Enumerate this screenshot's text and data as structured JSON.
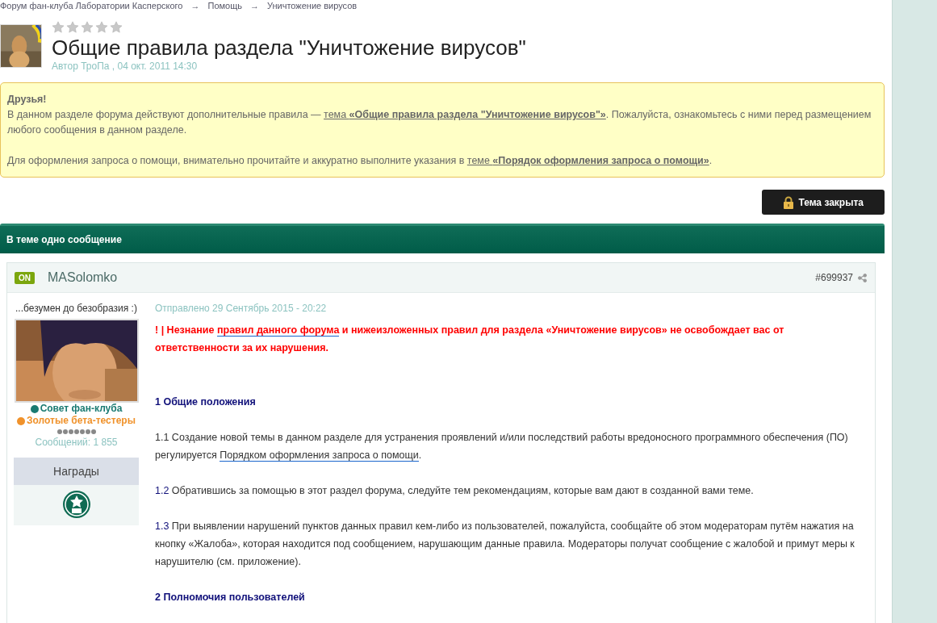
{
  "breadcrumb": [
    {
      "label": "Форум фан-клуба Лаборатории Касперского"
    },
    {
      "label": "Помощь"
    },
    {
      "label": "Уничтожение вирусов"
    }
  ],
  "breadcrumb_separator": "→",
  "topic": {
    "stars": 0,
    "title": "Общие правила раздела \"Уничтожение вирусов\"",
    "meta": "Автор ТроПа , 04 окт. 2011 14:30"
  },
  "notice": {
    "greeting": "Друзья!",
    "paragraphs": [
      [
        {
          "text": " В данном разделе форума действуют дополнительные правила — ",
          "link": false
        },
        {
          "text": "тема **«Общие правила раздела \"Уничтожение вирусов\"»**",
          "link": true
        },
        {
          "text": ". Пожалуйста, ознакомьтесь с ними перед размещением любого сообщения в данном разделе.",
          "link": false
        }
      ],
      [
        {
          "text": "Для оформления запроса о помощи, внимательно прочитайте и аккуратно выполните указания в ",
          "link": false
        },
        {
          "text": "теме **«Порядок оформления запроса о помощи»**",
          "link": true
        },
        {
          "text": ".",
          "link": false
        }
      ]
    ]
  },
  "closed_button": {
    "label": "Тема закрыта"
  },
  "post_count_bar": "В теме одно сообщение",
  "post": {
    "online_badge": "ON",
    "author": "MASolomko",
    "post_number": "#699937",
    "signature_title": "...безумен до безобразия :)",
    "groups": [
      {
        "label": "Совет фан-клуба",
        "color": "#1a7a72"
      },
      {
        "label": "Золотые бета-тестеры",
        "color": "#f0922b"
      }
    ],
    "message_count": "Сообщений: 1 855",
    "awards_title": "Награды",
    "date": "Отправлено 29 Сентябрь 2015 - 20:22",
    "body": [
      {
        "kind": "warning",
        "parts": [
          {
            "text": "! | Незнание ",
            "link": false
          },
          {
            "text": "правил данного форума",
            "link": true
          },
          {
            "text": " и нижеизложенных правил для раздела «Уничтожение вирусов» не освобождает вас от ответственности за их нарушения.",
            "link": false
          }
        ]
      },
      {
        "kind": "heading",
        "parts": [
          {
            "text": "1 Общие положения",
            "link": false
          }
        ]
      },
      {
        "kind": "para",
        "parts": [
          {
            "text": "1.1 Создание новой темы в данном разделе для устранения проявлений и/или последствий работы вредоносного программного обеспечения (ПО) регулируется ",
            "link": false
          },
          {
            "text": "Порядком оформления запроса о помощи",
            "link": true
          },
          {
            "text": ".",
            "link": false
          }
        ]
      },
      {
        "kind": "para",
        "number": "1.2",
        "parts": [
          {
            "text": " Обратившись за помощью в этот раздел форума, следуйте тем рекомендациям, которые вам дают в созданной вами теме.",
            "link": false
          }
        ]
      },
      {
        "kind": "para",
        "number": "1.3",
        "parts": [
          {
            "text": " При выявлении нарушений пунктов данных правил кем-либо из пользователей, пожалуйста, сообщайте об этом модераторам путём нажатия на кнопку «Жалоба», которая находится под сообщением, нарушающим данные правила. Модераторы получат сообщение с жалобой и примут меры к нарушителю (см. приложение).",
            "link": false
          }
        ]
      },
      {
        "kind": "heading",
        "parts": [
          {
            "text": "2 Полномочия пользователей",
            "link": false
          }
        ]
      }
    ]
  }
}
